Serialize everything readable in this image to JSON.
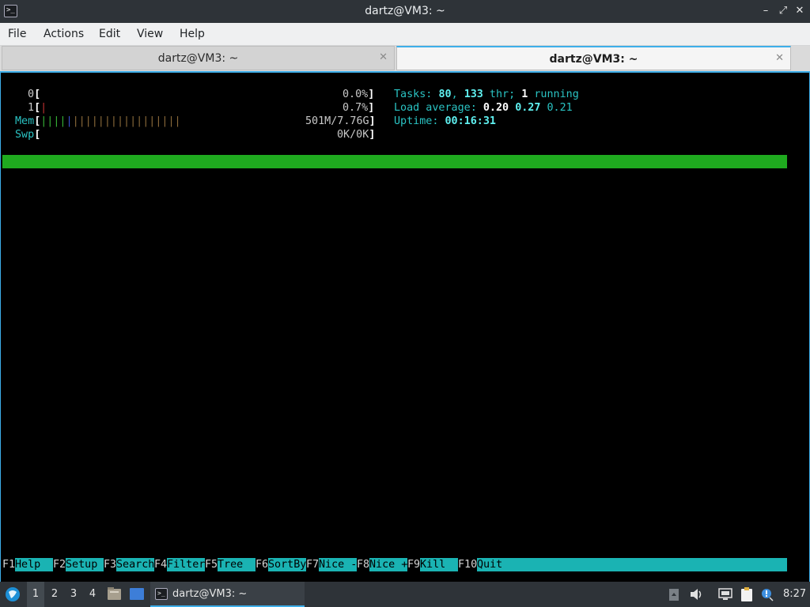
{
  "window": {
    "title": "dartz@VM3: ~",
    "app_icon_glyph": ">_",
    "controls": {
      "minimize": "–",
      "maximize": "⤢",
      "close": "✕"
    }
  },
  "menu": {
    "file": "File",
    "actions": "Actions",
    "edit": "Edit",
    "view": "View",
    "help": "Help"
  },
  "tabs": [
    {
      "label": "dartz@VM3: ~",
      "active": false,
      "close": "✕"
    },
    {
      "label": "dartz@VM3: ~",
      "active": true,
      "close": "✕"
    }
  ],
  "htop": {
    "cpu0": {
      "label": "0",
      "open": "[",
      "bars": "",
      "value": "0.0%",
      "close": "]"
    },
    "cpu1": {
      "label": "1",
      "open": "[",
      "bars": "|",
      "value": "0.7%",
      "close": "]"
    },
    "mem": {
      "label": "Mem",
      "open": "[",
      "bars_green": "||||",
      "bars_blue": "|",
      "bars_orange": "|||||||||||||||||",
      "value": "501M/7.76G",
      "close": "]"
    },
    "swp": {
      "label": "Swp",
      "open": "[",
      "value": "0K/0K",
      "close": "]"
    },
    "tasks": {
      "label": "Tasks: ",
      "count": "80",
      "sep": ", ",
      "threads": "133",
      "thr_label": " thr; ",
      "running": "1",
      "running_label": " running"
    },
    "load": {
      "label": "Load average: ",
      "l1": "0.20",
      "l5": "0.27",
      "l15": "0.21"
    },
    "uptime": {
      "label": "Uptime: ",
      "value": "00:16:31"
    },
    "fkeys": [
      {
        "key": "F1",
        "label": "Help  "
      },
      {
        "key": "F2",
        "label": "Setup "
      },
      {
        "key": "F3",
        "label": "Search"
      },
      {
        "key": "F4",
        "label": "Filter"
      },
      {
        "key": "F5",
        "label": "Tree  "
      },
      {
        "key": "F6",
        "label": "SortBy"
      },
      {
        "key": "F7",
        "label": "Nice -"
      },
      {
        "key": "F8",
        "label": "Nice +"
      },
      {
        "key": "F9",
        "label": "Kill  "
      },
      {
        "key": "F10",
        "label": "Quit"
      }
    ]
  },
  "taskbar": {
    "desktops": [
      "1",
      "2",
      "3",
      "4"
    ],
    "task_label": "dartz@VM3: ~",
    "clock": "8:27"
  },
  "colors": {
    "accent": "#3daee9",
    "htop_header": "#1faa1f",
    "htop_fkeys": "#1ab3b3"
  }
}
